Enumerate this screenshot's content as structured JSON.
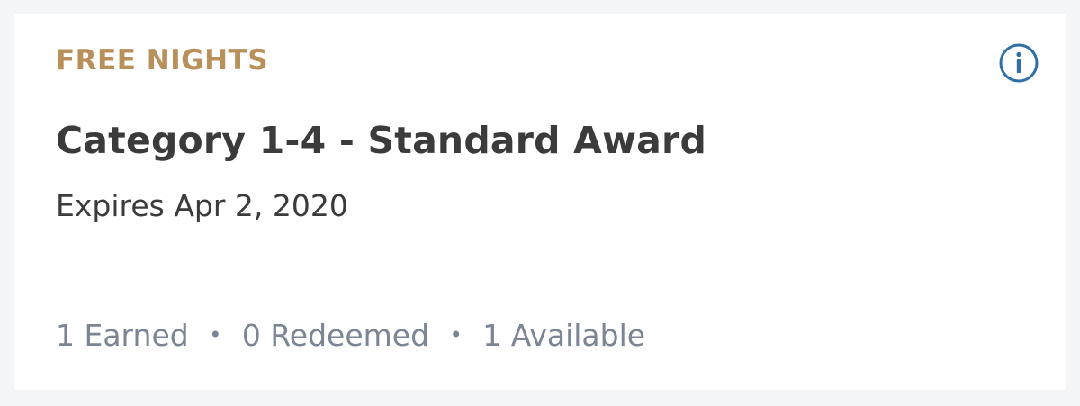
{
  "card": {
    "eyebrow": "FREE NIGHTS",
    "title": "Category 1-4 - Standard Award",
    "expires": "Expires Apr 2, 2020",
    "stats": {
      "earned": "1 Earned",
      "separator": "•",
      "redeemed": "0 Redeemed",
      "available": "1 Available"
    },
    "info_icon": "info-circle-icon"
  },
  "colors": {
    "eyebrow": "#b8905a",
    "info_icon": "#2f6fa6",
    "title_text": "#3b3b3b",
    "stats_text": "#7b8594",
    "page_bg": "#f4f5f7",
    "card_bg": "#ffffff"
  }
}
